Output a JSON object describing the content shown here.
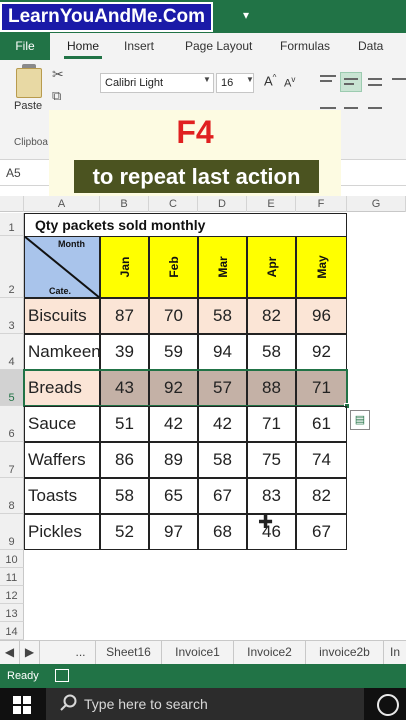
{
  "watermark": "LearnYouAndMe.Com",
  "ribbon": {
    "tabs": [
      "File",
      "Home",
      "Insert",
      "Page Layout",
      "Formulas",
      "Data"
    ],
    "paste_label": "Paste",
    "clipboard_label": "Clipboa",
    "font_name": "Calibri Light",
    "font_size": "16",
    "grow_font": "A",
    "shrink_font": "A"
  },
  "overlay": {
    "title": "F4",
    "subtitle": "to repeat last action"
  },
  "name_box": "A5",
  "columns": [
    "A",
    "B",
    "C",
    "D",
    "E",
    "F",
    "G"
  ],
  "rows": [
    "1",
    "2",
    "3",
    "4",
    "5",
    "6",
    "7",
    "8",
    "9",
    "10",
    "11",
    "12",
    "13",
    "14"
  ],
  "table": {
    "title": "Qty packets sold monthly",
    "corner_top": "Month",
    "corner_bottom": "Cate.",
    "months": [
      "Jan",
      "Feb",
      "Mar",
      "Apr",
      "May"
    ],
    "rows": [
      {
        "category": "Biscuits",
        "values": [
          "87",
          "70",
          "58",
          "82",
          "96"
        ]
      },
      {
        "category": "Namkeen",
        "values": [
          "39",
          "59",
          "94",
          "58",
          "92"
        ]
      },
      {
        "category": "Breads",
        "values": [
          "43",
          "92",
          "57",
          "88",
          "71"
        ]
      },
      {
        "category": "Sauce",
        "values": [
          "51",
          "42",
          "42",
          "71",
          "61"
        ]
      },
      {
        "category": "Waffers",
        "values": [
          "86",
          "89",
          "58",
          "75",
          "74"
        ]
      },
      {
        "category": "Toasts",
        "values": [
          "58",
          "65",
          "67",
          "83",
          "82"
        ]
      },
      {
        "category": "Pickles",
        "values": [
          "52",
          "97",
          "68",
          "46",
          "67"
        ]
      }
    ]
  },
  "sheet_tabs": [
    "...",
    "Sheet16",
    "Invoice1",
    "Invoice2",
    "invoice2b",
    "In"
  ],
  "status": "Ready",
  "taskbar": {
    "search_placeholder": "Type here to search"
  },
  "colors": {
    "excel_green": "#217346",
    "month_header": "#ffff00",
    "corner": "#a9c4eb",
    "peach": "#fbe5d6",
    "taupe": "#c4b1a6",
    "banner_red": "#e02020",
    "banner_olive": "#4b5320"
  }
}
